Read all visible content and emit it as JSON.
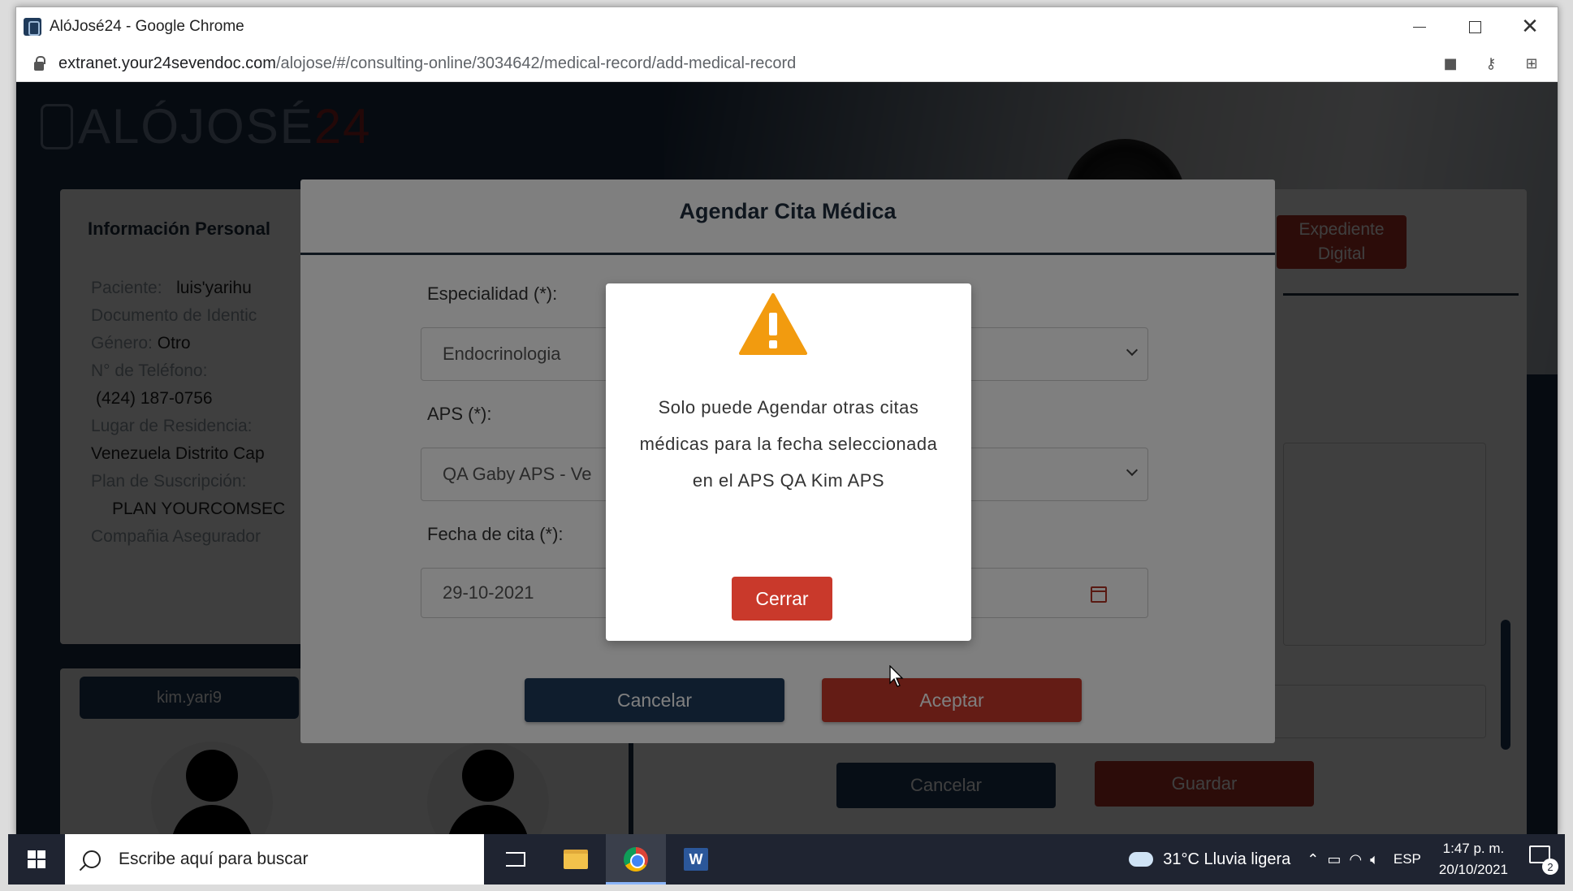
{
  "window": {
    "title": "AlóJosé24 - Google Chrome",
    "url_domain": "extranet.your24sevendoc.com",
    "url_path": "/alojose/#/consulting-online/3034642/medical-record/add-medical-record"
  },
  "app": {
    "logo_text": "ALÓJOSÉ",
    "logo_num": "24",
    "personal_info": {
      "heading": "Información Personal",
      "patient_label": "Paciente:",
      "patient_value": "luis'yarihu",
      "document_label": "Documento de Identic",
      "gender_label": "Género:",
      "gender_value": "Otro",
      "phone_label": "N° de Teléfono:",
      "phone_value": "(424) 187-0756",
      "residence_label": "Lugar de Residencia:",
      "residence_value": "Venezuela Distrito Cap",
      "plan_label": "Plan de Suscripción:",
      "plan_value": "PLAN YOURCOMSEC",
      "insurer_label": "Compañia Asegurador"
    },
    "user_pill": "kim.yari9",
    "expediente_button": "Expediente Digital",
    "background_cancel": "Cancelar",
    "background_save": "Guardar"
  },
  "modal": {
    "title": "Agendar Cita Médica",
    "especialidad_label": "Especialidad (*):",
    "especialidad_value": "Endocrinologia",
    "aps_label": "APS (*):",
    "aps_value": "QA Gaby APS - Ve",
    "fecha_label": "Fecha de cita (*):",
    "fecha_value": "29-10-2021",
    "cancel_label": "Cancelar",
    "accept_label": "Aceptar"
  },
  "alert": {
    "message": "Solo puede Agendar otras citas médicas para la fecha seleccionada en el APS QA Kim APS",
    "close_label": "Cerrar"
  },
  "taskbar": {
    "search_placeholder": "Escribe aquí para buscar",
    "weather": "31°C  Lluvia ligera",
    "language": "ESP",
    "time": "1:47 p. m.",
    "date": "20/10/2021",
    "notifications": "2"
  },
  "colors": {
    "navy": "#1f3a5a",
    "red": "#c9392b",
    "warning": "#f29b0f"
  }
}
